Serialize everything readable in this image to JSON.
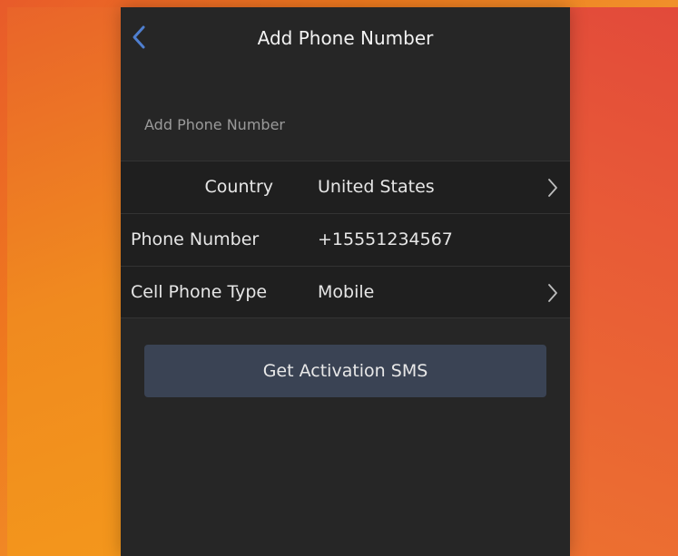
{
  "nav": {
    "title": "Add Phone Number",
    "back_icon": "chevron-left-icon"
  },
  "section": {
    "header": "Add Phone Number"
  },
  "form": {
    "country": {
      "label": "Country",
      "value": "United States"
    },
    "phone": {
      "label": "Phone Number",
      "value": "+15551234567"
    },
    "cell_type": {
      "label": "Cell Phone Type",
      "value": "Mobile"
    }
  },
  "actions": {
    "get_sms_label": "Get Activation SMS"
  },
  "colors": {
    "background_panel": "#262626",
    "row_background": "#1f1f1f",
    "button": "#3a4354",
    "accent_back": "#4f7fd0"
  }
}
